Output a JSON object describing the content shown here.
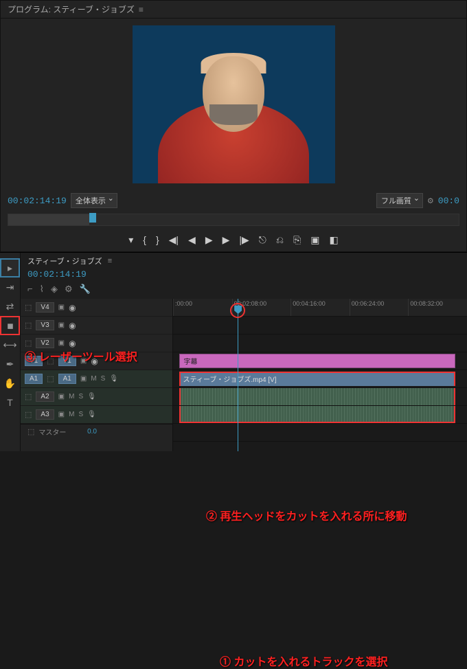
{
  "program": {
    "title": "プログラム: スティーブ・ジョブズ",
    "timecode": "00:02:14:19",
    "zoom_label": "全体表示",
    "quality_label": "フル画質",
    "duration": "00:0"
  },
  "transport": {
    "marker": "▾",
    "in": "{",
    "out": "}",
    "goto_in": "◀|",
    "step_back": "◀",
    "play": "▶",
    "step_fwd": "▶",
    "goto_out": "|▶",
    "lift": "⎋",
    "extract": "⎌",
    "export": "⎘",
    "camera": "▣",
    "compare": "◧"
  },
  "timeline": {
    "sequence_name": "スティーブ・ジョブズ",
    "timecode": "00:02:14:19",
    "ruler": [
      ":00:00",
      "00:02:08:00",
      "00:04:16:00",
      "00:06:24:00",
      "00:08:32:00"
    ],
    "tracks": {
      "v4": "V4",
      "v3": "V3",
      "v2": "V2",
      "v1": "V1",
      "a1_src": "A1",
      "a1": "A1",
      "a2": "A2",
      "a3": "A3"
    },
    "clips": {
      "subtitle": "字幕",
      "video": "スティーブ・ジョブズ.mp4 [V]"
    },
    "master_label": "マスター",
    "master_value": "0.0",
    "toggles": {
      "m": "M",
      "s": "S"
    }
  },
  "annotations": {
    "a1": "① カットを入れるトラックを選択",
    "a2": "② 再生ヘッドをカットを入れる所に移動",
    "a3": "③ レーザーツール選択"
  }
}
